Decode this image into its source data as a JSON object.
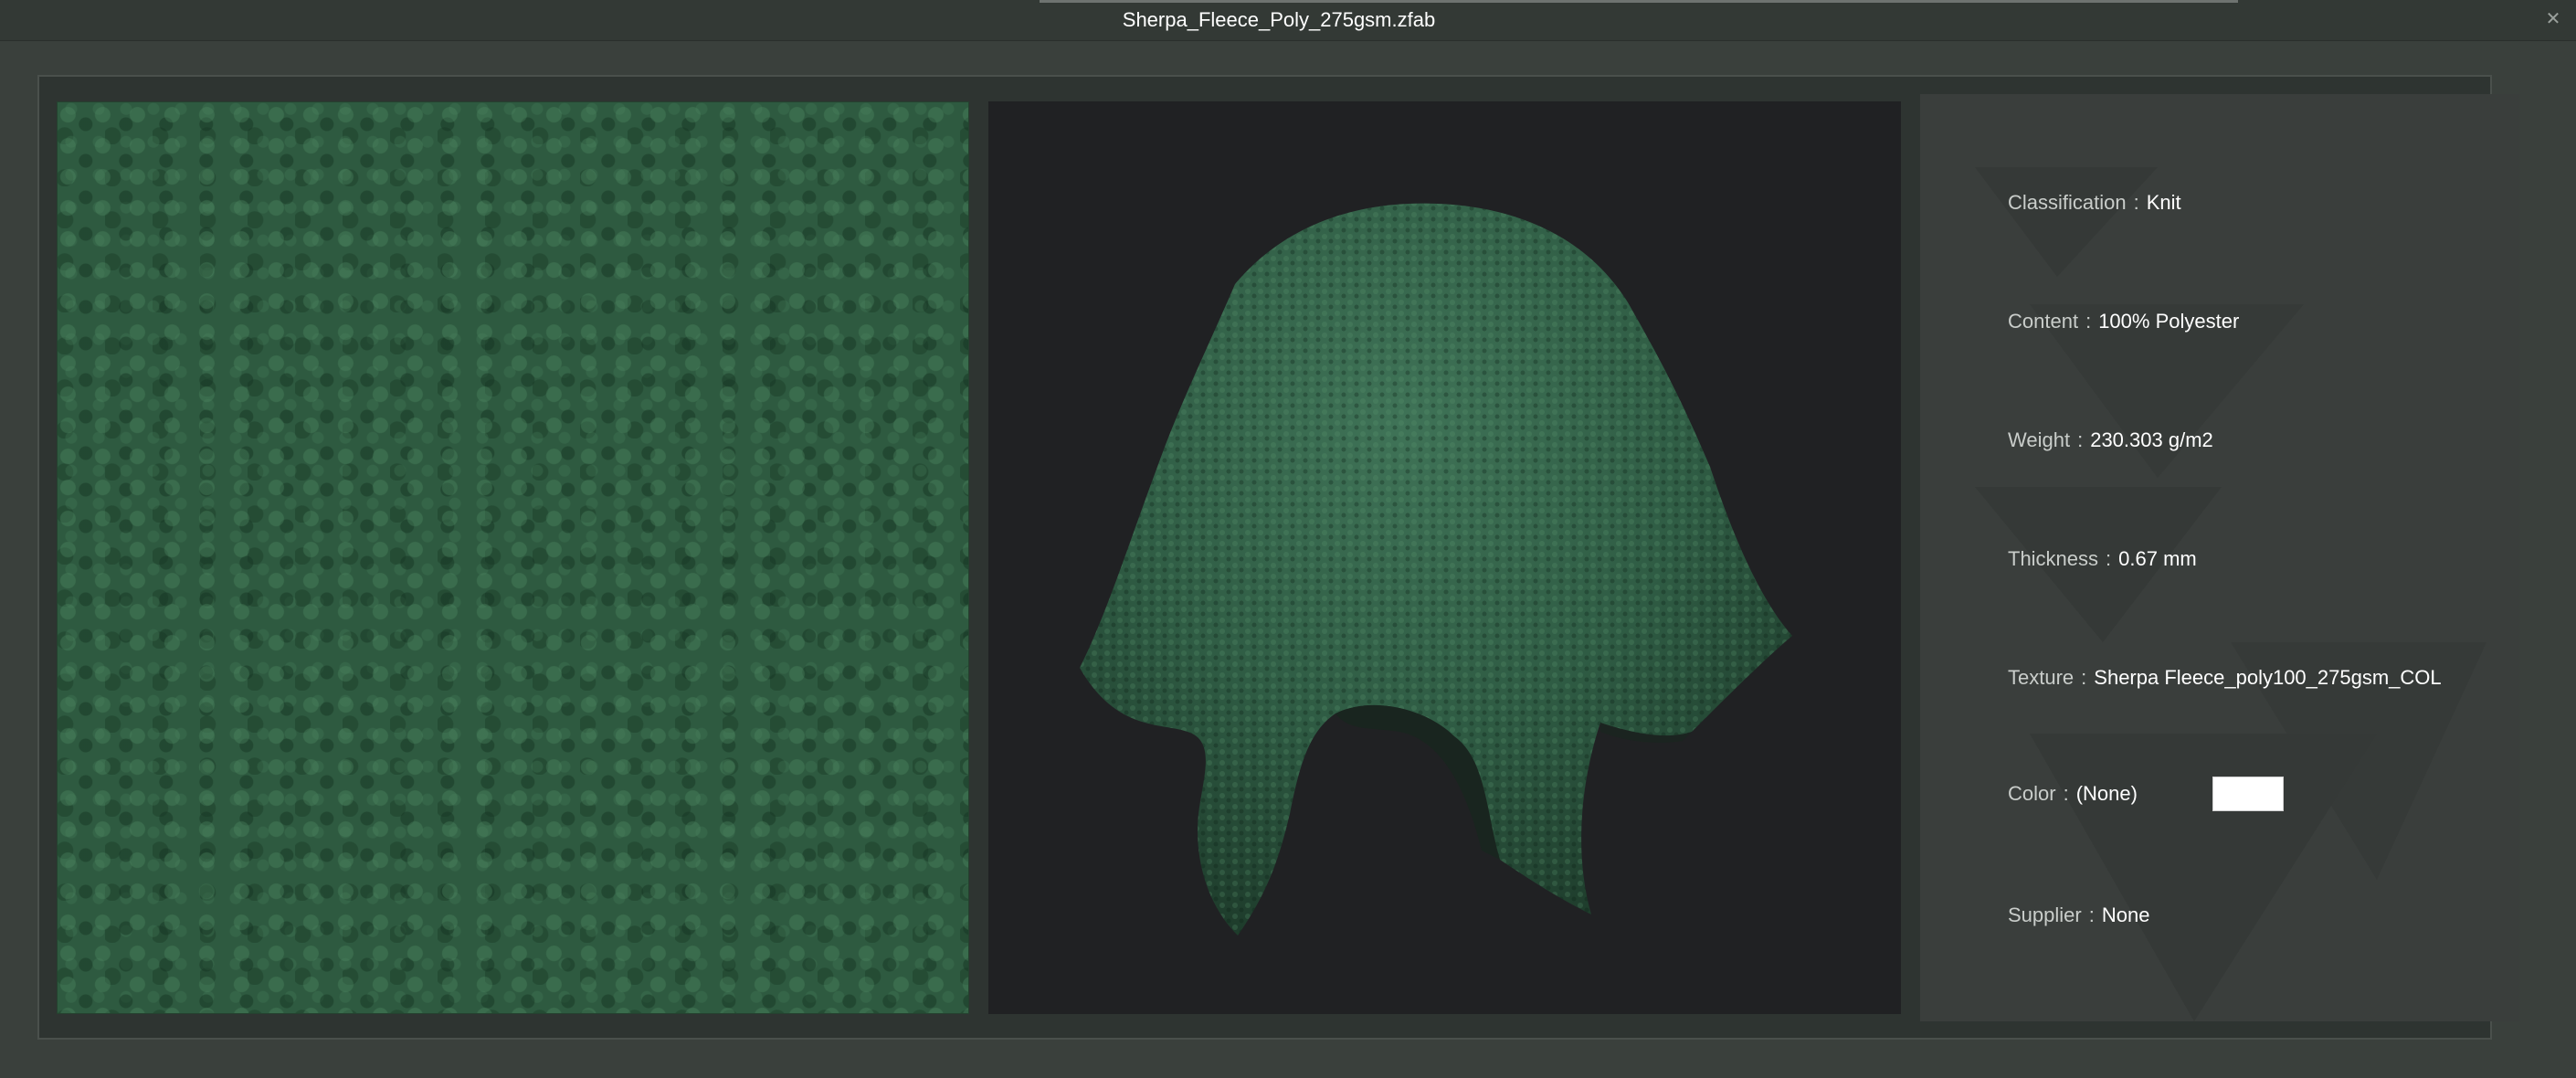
{
  "window": {
    "title": "Sherpa_Fleece_Poly_275gsm.zfab",
    "close_icon": "close-icon"
  },
  "fabric": {
    "swatch_color": "#2e5a40",
    "preview_background": "#202123"
  },
  "properties": [
    {
      "key": "classification",
      "label": "Classification",
      "value": "Knit"
    },
    {
      "key": "content",
      "label": "Content",
      "value": "100% Polyester"
    },
    {
      "key": "weight",
      "label": "Weight",
      "value": "230.303 g/m2"
    },
    {
      "key": "thickness",
      "label": "Thickness",
      "value": "0.67 mm"
    },
    {
      "key": "texture",
      "label": "Texture",
      "value": "Sherpa Fleece_poly100_275gsm_COL"
    },
    {
      "key": "color",
      "label": "Color",
      "value": "(None)",
      "chip_color": "#ffffff"
    },
    {
      "key": "supplier",
      "label": "Supplier",
      "value": "None"
    }
  ],
  "separator": ":"
}
